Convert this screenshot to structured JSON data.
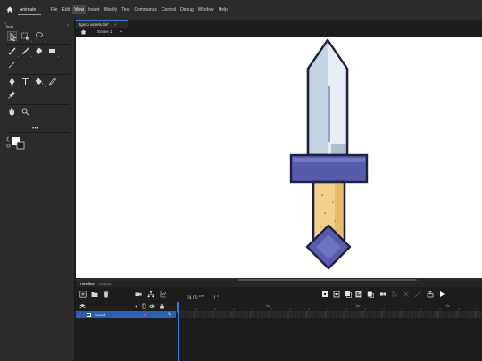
{
  "app": {
    "name": "Animate"
  },
  "menu": [
    "File",
    "Edit",
    "View",
    "Insert",
    "Modify",
    "Text",
    "Commands",
    "Control",
    "Debug",
    "Window",
    "Help"
  ],
  "menu_active": "View",
  "tools_panel": {
    "chevron": "»",
    "title": "Tools",
    "menu_icon": "≡",
    "more": "•••"
  },
  "document": {
    "tab_title": "tgsco assets.fla*",
    "close": "×",
    "scene": "Scene 1",
    "scene_chevron": "⌄"
  },
  "timeline": {
    "tabs": [
      "Timeline",
      "Output"
    ],
    "fps": "24.00",
    "fps_unit": "FPS",
    "frame": "1",
    "frame_unit": "F",
    "ruler_markers": [
      "1s",
      "2s",
      "3s"
    ],
    "layers": [
      {
        "name": "sword",
        "selected": true
      }
    ]
  },
  "colors": {
    "accent": "#2d7de0",
    "layer_selected": "#2d5fb4",
    "blade": "#c5d3e3",
    "guard": "#575bab",
    "handle": "#f2d18c",
    "pommel": "#575bab",
    "outline": "#1f2140"
  },
  "icons": {
    "home": "home-icon",
    "tools": [
      "selection-tool-icon",
      "subselection-tool-icon",
      "lasso-tool-icon",
      "brush-tool-icon",
      "pencil-tool-icon",
      "eraser-tool-icon",
      "rectangle-tool-icon",
      "line-tool-icon",
      "pen-tool-icon",
      "text-tool-icon",
      "paint-bucket-tool-icon",
      "eyedropper-tool-icon",
      "pin-tool-icon",
      "hand-tool-icon",
      "zoom-tool-icon",
      "stroke-fill-color-icon"
    ]
  }
}
